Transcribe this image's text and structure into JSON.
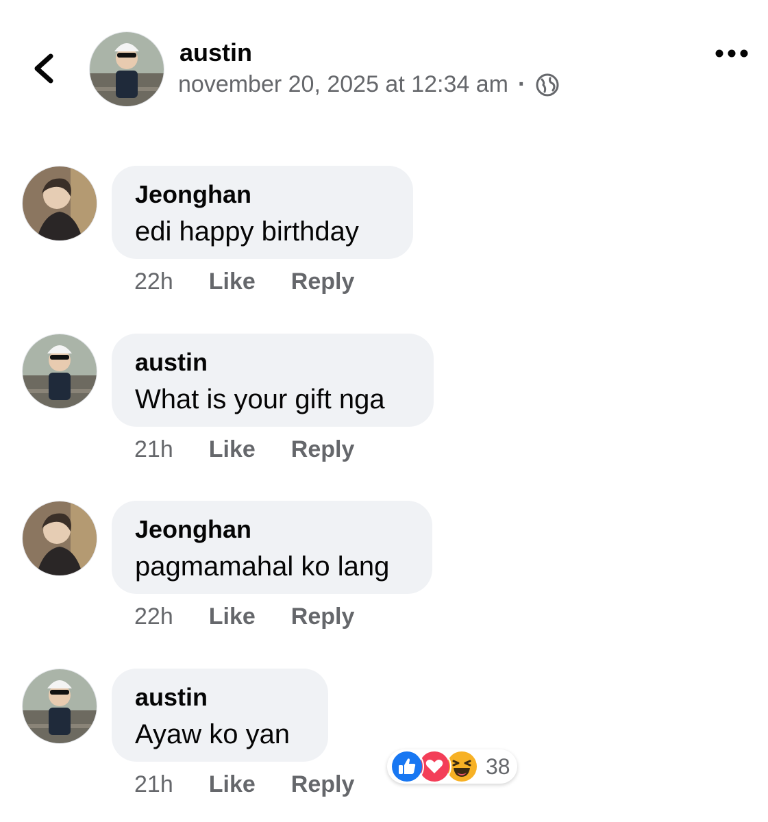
{
  "post": {
    "author": "austin",
    "timestamp": "november 20, 2025 at 12:34 am",
    "separator": "·",
    "audience_icon": "globe-icon"
  },
  "comments": [
    {
      "author": "Jeonghan",
      "text": "edi happy birthday",
      "time": "22h",
      "like_label": "Like",
      "reply_label": "Reply"
    },
    {
      "author": "austin",
      "text": "What is your gift nga",
      "time": "21h",
      "like_label": "Like",
      "reply_label": "Reply"
    },
    {
      "author": "Jeonghan",
      "text": "pagmamahal ko lang",
      "time": "22h",
      "like_label": "Like",
      "reply_label": "Reply"
    },
    {
      "author": "austin",
      "text": "Ayaw ko yan",
      "time": "21h",
      "like_label": "Like",
      "reply_label": "Reply"
    }
  ],
  "reactions": {
    "icons": [
      "like-icon",
      "love-icon",
      "haha-icon"
    ],
    "count": "38"
  },
  "colors": {
    "bubble": "#f0f2f5",
    "secondary_text": "#65676b",
    "like_blue": "#1877f2",
    "love_red": "#f33e58",
    "haha_yellow": "#f7b125"
  }
}
